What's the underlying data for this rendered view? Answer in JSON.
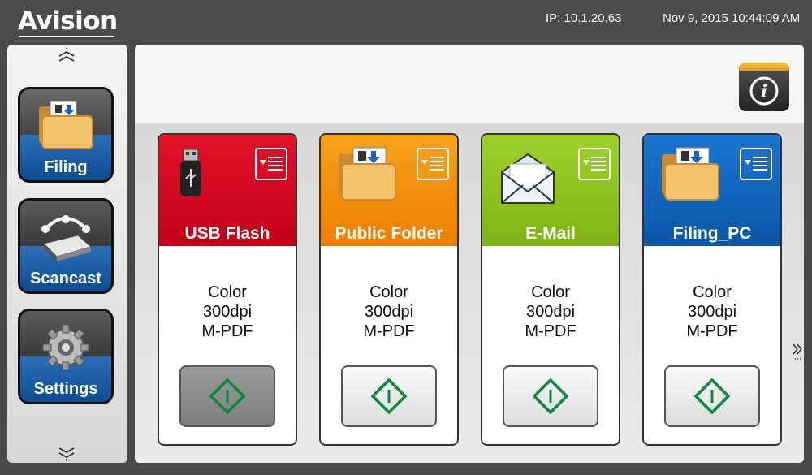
{
  "header": {
    "logo_text": "Avision",
    "ip": "IP: 10.1.20.63",
    "datetime": "Nov 9, 2015 10:44:09 AM"
  },
  "sidebar": {
    "items": [
      {
        "label": "Filing",
        "icon": "folder-icon",
        "active": true
      },
      {
        "label": "Scancast",
        "icon": "scanner-icon",
        "active": false
      },
      {
        "label": "Settings",
        "icon": "gear-icon",
        "active": false
      }
    ]
  },
  "cards": [
    {
      "title": "USB Flash",
      "color": "#d8001c",
      "icon": "usb-flash-icon",
      "lines": [
        "Color",
        "300dpi",
        "M-PDF"
      ]
    },
    {
      "title": "Public Folder",
      "color": "#f28a00",
      "icon": "folder-icon",
      "lines": [
        "Color",
        "300dpi",
        "M-PDF"
      ]
    },
    {
      "title": "E-Mail",
      "color": "#8cc21f",
      "icon": "envelope-icon",
      "lines": [
        "Color",
        "300dpi",
        "M-PDF"
      ]
    },
    {
      "title": "Filing_PC",
      "color": "#0a5fb8",
      "icon": "folder-icon",
      "lines": [
        "Color",
        "300dpi",
        "M-PDF"
      ]
    }
  ],
  "colors": {
    "start_diamond": "#0a8a3a",
    "nav_blue": "#0f4c91",
    "info_band": "#f0b429"
  }
}
